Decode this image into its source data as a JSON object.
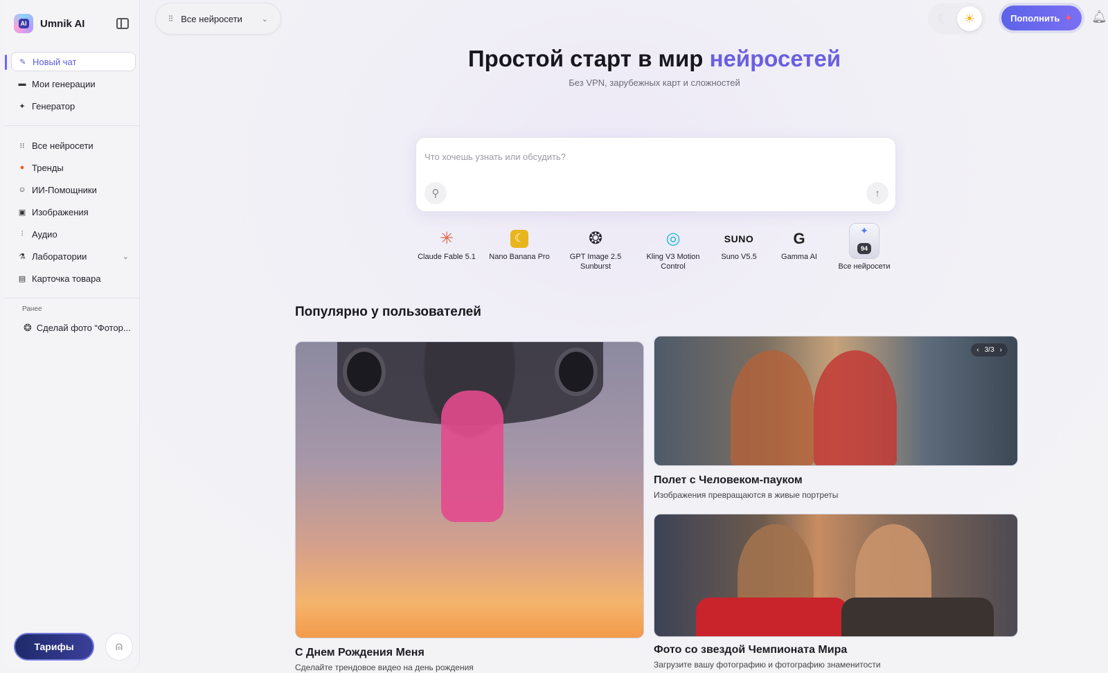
{
  "brand": {
    "name": "Umnik AI",
    "logo_text": "AI"
  },
  "sidebar": {
    "primary": [
      {
        "label": "Новый чат",
        "icon": "pencil-icon",
        "active": true
      },
      {
        "label": "Мои генерации",
        "icon": "folder-icon"
      },
      {
        "label": "Генератор",
        "icon": "sparkle-icon"
      }
    ],
    "secondary": [
      {
        "label": "Все нейросети",
        "icon": "grid-icon"
      },
      {
        "label": "Тренды",
        "icon": "fire-icon"
      },
      {
        "label": "ИИ-Помощники",
        "icon": "robot-icon"
      },
      {
        "label": "Изображения",
        "icon": "image-icon"
      },
      {
        "label": "Аудио",
        "icon": "audio-icon"
      },
      {
        "label": "Лаборатории",
        "icon": "flask-icon",
        "has_submenu": true
      },
      {
        "label": "Карточка товара",
        "icon": "card-icon"
      }
    ],
    "history_title": "Ранее",
    "history": [
      {
        "label": "Сделай фото “Фотор...",
        "icon": "openai-icon"
      }
    ],
    "tariffs_label": "Тарифы"
  },
  "topbar": {
    "model_selector": "Все нейросети",
    "topup_label": "Пополнить"
  },
  "hero": {
    "title_main": "Простой старт в мир ",
    "title_accent": "нейросетей",
    "subtitle": "Без VPN, зарубежных карт и сложностей"
  },
  "chat": {
    "placeholder": "Что хочешь узнать или обсудить?"
  },
  "models": [
    {
      "line1": "Claude Fable 5.1",
      "line2": "",
      "icon": "claude-icon"
    },
    {
      "line1": "Nano Banana Pro",
      "line2": "",
      "icon": "banana-icon"
    },
    {
      "line1": "GPT Image 2.5",
      "line2": "Sunburst",
      "icon": "openai-icon"
    },
    {
      "line1": "Kling V3 Motion",
      "line2": "Control",
      "icon": "kling-icon"
    },
    {
      "line1": "Suno V5.5",
      "line2": "",
      "icon": "suno-icon",
      "logo_text": "SUNO"
    },
    {
      "line1": "Gamma AI",
      "line2": "",
      "icon": "gamma-icon",
      "logo_text": "G"
    },
    {
      "line1": "Все нейросети",
      "line2": "",
      "icon": "all-models-icon",
      "badge": "94"
    }
  ],
  "popular": {
    "title": "Популярно у пользователей",
    "cards": [
      {
        "title": "С Днем Рождения Меня",
        "subtitle": "Сделайте трендовое видео на день рождения"
      },
      {
        "title": "Полет с Человеком-пауком",
        "subtitle": "Изображения превращаются в живые портреты",
        "counter": "3/3"
      },
      {
        "title": "Фото со звездой Чемпионата Мира",
        "subtitle": "Загрузите вашу фотографию и фотографию знаменитости"
      }
    ]
  },
  "colors": {
    "accent": "#6a5fe0",
    "topup": "#5c63e8",
    "tariffs": "#1e2a6a"
  }
}
